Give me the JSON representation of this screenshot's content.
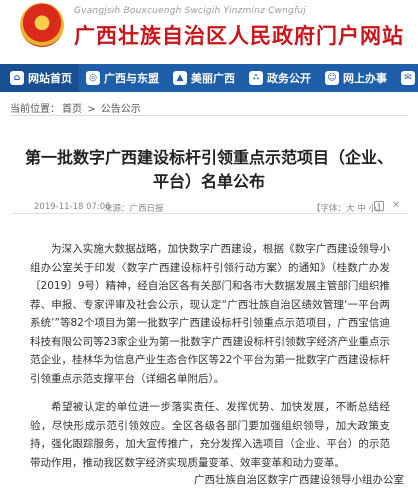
{
  "header": {
    "pinyin": "Gvangjsih Bouxcuengh Swcigih Yinzminz Cwngfuj",
    "title": "广西壮族自治区人民政府门户网站",
    "emblem_icon": "national-emblem-icon",
    "accent_color": "#c8161d"
  },
  "nav": {
    "bg_color": "#1f5ea8",
    "items": [
      {
        "label": "网站首页",
        "icon": "home-icon"
      },
      {
        "label": "广西与东盟",
        "icon": "globe-icon"
      },
      {
        "label": "美丽广西",
        "icon": "landscape-icon"
      },
      {
        "label": "政务公开",
        "icon": "dots-icon"
      },
      {
        "label": "网上办事",
        "icon": "person-icon"
      },
      {
        "label": "互",
        "icon": "chat-icon"
      }
    ]
  },
  "breadcrumb": {
    "prefix": "当前位置：",
    "home": "首页",
    "sep": ">",
    "current": "公告公示"
  },
  "article": {
    "title": "第一批数字广西建设标杆引领重点示范项目（企业、平台）名单公布",
    "date": "2019-11-18 07:06",
    "source": "来源：广西日报",
    "font_size": "【字体：大 中 小】",
    "paragraphs": [
      "为深入实施大数据战略，加快数字广西建设，根据《数字广西建设领导小组办公室关于印发〈数字广西建设标杆引领行动方案〉的通知》（桂数广办发〔2019〕9号）精神，经自治区各有关部门和各市大数据发展主管部门组织推荐、申报、专家评审及社会公示，现认定“广西壮族自治区绩效管理‘一平台两系统’”等82个项目为第一批数字广西建设标杆引领重点示范项目，广西宝信迪科技有限公司等23家企业为第一批数字广西建设标杆引领数字经济产业重点示范企业，桂林华为信息产业生态合作区等22个平台为第一批数字广西建设标杆引领重点示范支撑平台（详细名单附后）。",
      "希望被认定的单位进一步落实责任、发挥优势、加快发展，不断总结经验，尽快形成示范引领效应。全区各级各部门要加强组织领导，加大政策支持，强化跟踪服务，加大宣传推广，充分发挥入选项目（企业、平台）的示范带动作用，推动我区数字经济实现质量变革、效率变革和动力变革。"
    ],
    "signature": "广西壮族自治区数字广西建设领导小组办公室"
  }
}
